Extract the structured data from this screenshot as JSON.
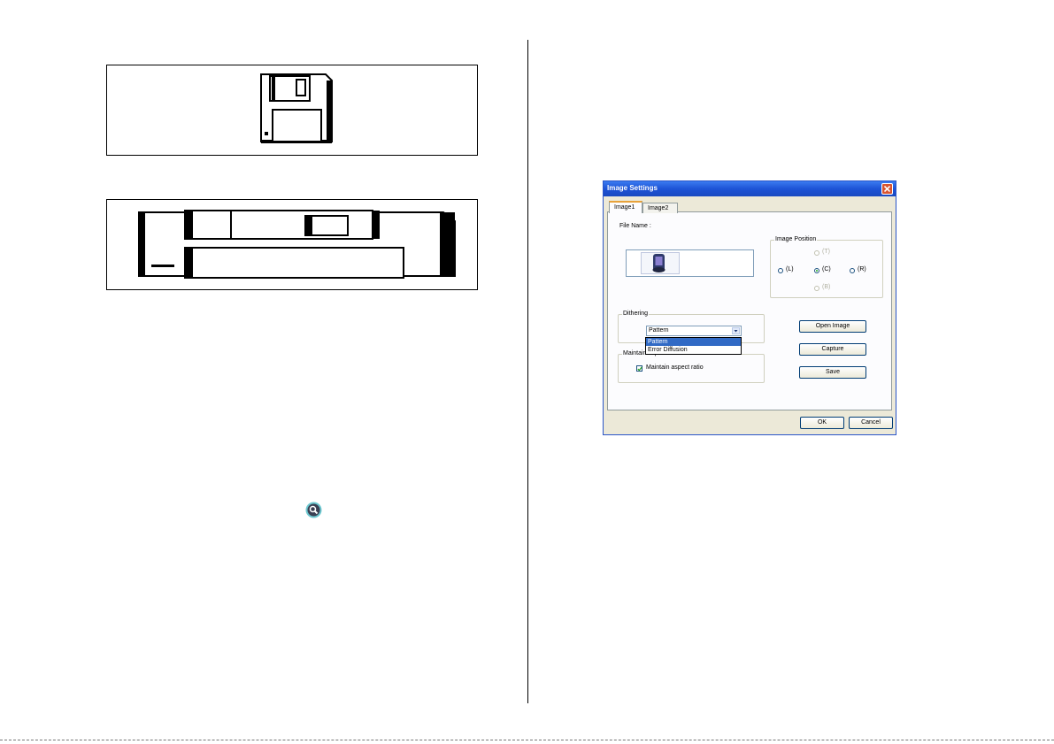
{
  "dialog": {
    "title": "Image Settings",
    "tabs": [
      {
        "label": "Image1",
        "active": true
      },
      {
        "label": "Image2",
        "active": false
      }
    ],
    "file_name_label": "File Name :",
    "image_position": {
      "label": "Image Position",
      "options": [
        {
          "label": "(T)",
          "enabled": false,
          "selected": false
        },
        {
          "label": "(L)",
          "enabled": true,
          "selected": false
        },
        {
          "label": "(C)",
          "enabled": true,
          "selected": true
        },
        {
          "label": "(R)",
          "enabled": true,
          "selected": false
        },
        {
          "label": "(B)",
          "enabled": false,
          "selected": false
        }
      ]
    },
    "dithering": {
      "label": "Dithering",
      "selected_value": "Pattern",
      "options": [
        "Pattern",
        "Error Diffusion"
      ]
    },
    "maintain_group_label": "Maintain aspect",
    "maintain_checkbox": {
      "label": "Maintain aspect ratio",
      "checked": true
    },
    "buttons": {
      "open_image": "Open Image",
      "capture": "Capture",
      "save": "Save",
      "ok": "OK",
      "cancel": "Cancel"
    }
  },
  "icons": {
    "floppy": "floppy-disk-icon",
    "card": "memory-card-icon",
    "zoom": "magnifier-icon"
  },
  "colors": {
    "titlebar": "#1d53d6",
    "close": "#d9542f",
    "selection": "#316ac5",
    "dialog_bg": "#ece9d8"
  }
}
